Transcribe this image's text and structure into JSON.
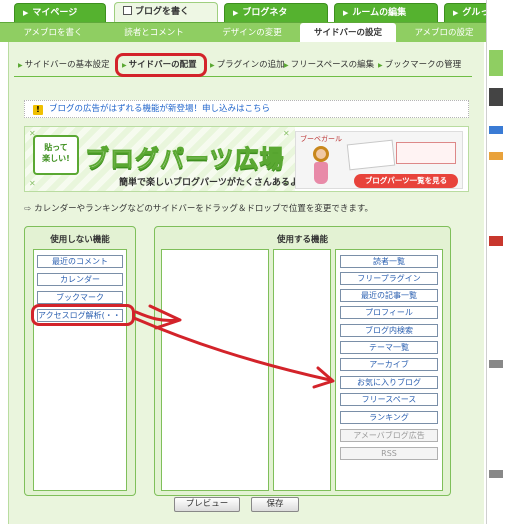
{
  "top_tabs": [
    {
      "label": "マイページ",
      "active": false
    },
    {
      "label": "ブログを書く",
      "active": true
    },
    {
      "label": "ブログネタ",
      "active": false
    },
    {
      "label": "ルームの編集",
      "active": false
    },
    {
      "label": "グルっぽ",
      "active": false
    }
  ],
  "sub_nav": [
    {
      "label": "アメブロを書く",
      "active": false
    },
    {
      "label": "読者とコメント",
      "active": false
    },
    {
      "label": "デザインの変更",
      "active": false
    },
    {
      "label": "サイドバーの設定",
      "active": true
    },
    {
      "label": "アメブロの設定",
      "active": false
    }
  ],
  "settings_tabs": [
    {
      "label": "サイドバーの基本設定",
      "active": false
    },
    {
      "label": "サイドバーの配置",
      "active": true
    },
    {
      "label": "プラグインの追加",
      "active": false
    },
    {
      "label": "フリースペースの編集",
      "active": false
    },
    {
      "label": "ブックマークの管理",
      "active": false
    }
  ],
  "notice": {
    "icon": "warning-icon",
    "text": "ブログの広告がはずれる機能が新登場！申し込みはこちら"
  },
  "banner": {
    "bubble_text_1": "貼って",
    "bubble_text_2": "楽しい!",
    "title": "ブログパーツ広場",
    "subtitle": "簡単で楽しいブログパーツがたくさんあるよ！",
    "girl_label": "ブーベガール",
    "cta": "ブログパーツ一覧を見る"
  },
  "instruction": "カレンダーやランキングなどのサイドバーをドラッグ＆ドロップで位置を変更できます。",
  "unused": {
    "title": "使用しない機能",
    "items": [
      {
        "label": "最近のコメント",
        "disabled": false
      },
      {
        "label": "カレンダー",
        "disabled": false
      },
      {
        "label": "ブックマーク",
        "disabled": false
      },
      {
        "label": "アクセスログ解析(・・・",
        "disabled": false
      }
    ]
  },
  "used": {
    "title": "使用する機能",
    "items": [
      {
        "label": "読者一覧",
        "disabled": false
      },
      {
        "label": "フリープラグイン",
        "disabled": false
      },
      {
        "label": "最近の記事一覧",
        "disabled": false
      },
      {
        "label": "プロフィール",
        "disabled": false
      },
      {
        "label": "ブログ内検索",
        "disabled": false
      },
      {
        "label": "テーマ一覧",
        "disabled": false
      },
      {
        "label": "アーカイブ",
        "disabled": false
      },
      {
        "label": "お気に入りブログ",
        "disabled": false
      },
      {
        "label": "フリースペース",
        "disabled": false
      },
      {
        "label": "ランキング",
        "disabled": false
      },
      {
        "label": "アメーバブログ広告",
        "disabled": true
      },
      {
        "label": "RSS",
        "disabled": true
      }
    ]
  },
  "buttons": {
    "preview": "プレビュー",
    "save": "保存"
  },
  "colors": {
    "accent_green": "#55b22f",
    "annotation_red": "#d3232a",
    "link_blue": "#2a5fb0"
  }
}
